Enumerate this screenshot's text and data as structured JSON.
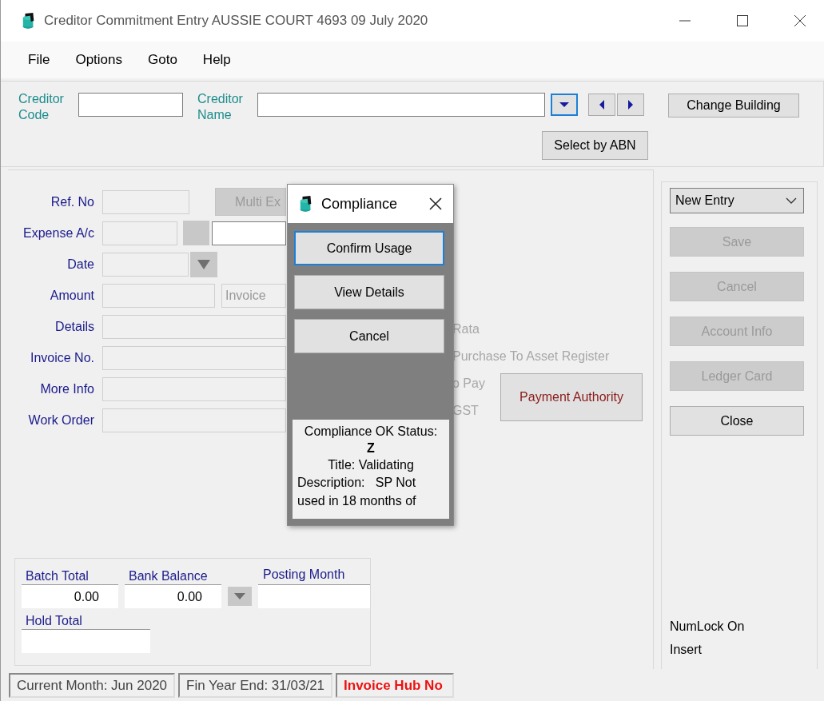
{
  "window": {
    "title": "Creditor Commitment Entry AUSSIE COURT 4693 09 July 2020"
  },
  "menu": [
    "File",
    "Options",
    "Goto",
    "Help"
  ],
  "header": {
    "code_label": "Creditor Code",
    "name_label": "Creditor Name",
    "change_building": "Change Building",
    "select_by_abn": "Select by ABN"
  },
  "form": {
    "rows": [
      {
        "kind": "ref",
        "label": "Ref. No",
        "button": "Multi Ex"
      },
      {
        "kind": "expense",
        "label": "Expense A/c"
      },
      {
        "kind": "date",
        "label": "Date"
      },
      {
        "kind": "amount",
        "label": "Amount",
        "value": "Invoice"
      },
      {
        "kind": "text",
        "label": "Details"
      },
      {
        "kind": "text",
        "label": "Invoice No."
      },
      {
        "kind": "text",
        "label": "More Info"
      },
      {
        "kind": "text",
        "label": "Work Order"
      }
    ],
    "options": [
      "Rata",
      "Purchase To Asset Register",
      "o Pay",
      "GST"
    ],
    "payment_authority": "Payment Authority"
  },
  "totals": {
    "batch_label": "Batch Total",
    "batch_value": "0.00",
    "bank_label": "Bank Balance",
    "bank_value": "0.00",
    "posting_label": "Posting Month",
    "hold_label": "Hold Total"
  },
  "actions": {
    "mode": "New Entry",
    "buttons": [
      {
        "label": "Save",
        "disabled": true
      },
      {
        "label": "Cancel",
        "disabled": true
      },
      {
        "label": "Account Info",
        "disabled": true
      },
      {
        "label": "Ledger Card",
        "disabled": true
      },
      {
        "label": "Close",
        "disabled": false
      }
    ],
    "numlock": "NumLock On",
    "insert": "Insert"
  },
  "status_bar": [
    {
      "text": "Current Month: Jun 2020",
      "kind": "plain"
    },
    {
      "text": "Fin Year End: 31/03/21",
      "kind": "plain"
    },
    {
      "text": "Invoice Hub No",
      "kind": "alert"
    }
  ],
  "dialog": {
    "title": "Compliance",
    "buttons": [
      {
        "label": "Confirm Usage",
        "focused": true
      },
      {
        "label": "View Details",
        "focused": false
      },
      {
        "label": "Cancel",
        "focused": false
      }
    ],
    "status_label": "Compliance OK Status:",
    "status": "Z",
    "title_line": "Title: Validating",
    "description": "Description:   SP Not used in 18 months of"
  }
}
